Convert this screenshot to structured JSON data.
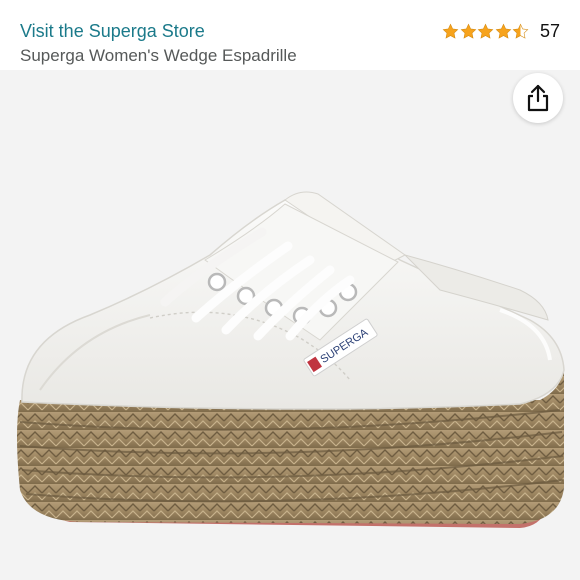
{
  "header": {
    "store_link": "Visit the Superga Store",
    "product_title": "Superga Women's Wedge Espadrille"
  },
  "rating": {
    "stars": 4.5,
    "review_count": "57",
    "star_color": "#f7a31c"
  },
  "product_image": {
    "brand_label": "SUPERGA"
  },
  "share": {
    "icon": "share-icon"
  }
}
